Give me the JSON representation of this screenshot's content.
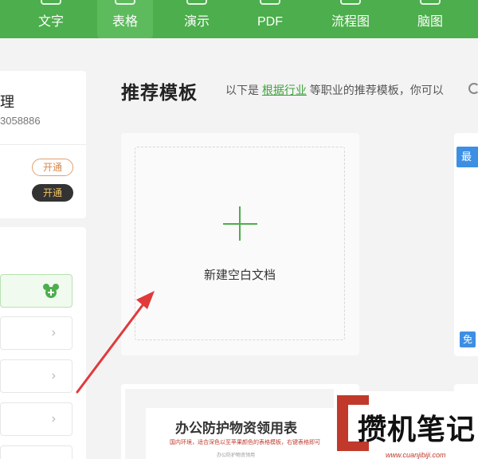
{
  "nav": {
    "tabs": [
      {
        "label": "文字"
      },
      {
        "label": "表格"
      },
      {
        "label": "演示"
      },
      {
        "label": "PDF"
      },
      {
        "label": "流程图"
      },
      {
        "label": "脑图"
      }
    ],
    "active_tab": "表格"
  },
  "account": {
    "name": "理",
    "id": "3058886",
    "open_outline_label": "开通",
    "open_dark_label": "开通"
  },
  "sidebar": {
    "items": [
      {
        "label": "",
        "selected": true
      },
      {
        "label": ""
      },
      {
        "label": ""
      },
      {
        "label": ""
      },
      {
        "label": ""
      }
    ]
  },
  "header": {
    "title": "推荐模板",
    "prefix": "以下是",
    "link": "根据行业",
    "suffix": "等职业的推荐模板，你可以"
  },
  "new_doc": {
    "label": "新建空白文档"
  },
  "side_card": {
    "badge_new": "最新",
    "badge_free": "免"
  },
  "template": {
    "title": "办公防护物资领用表",
    "subtitle": "国内环境，适合深色以至苹果颜色的表格模板，右键表格即可",
    "small": "办公防护物资领用"
  },
  "watermark": {
    "text": "攒机笔记",
    "url": "www.cuanjibiji.com"
  },
  "colors": {
    "brand": "#4cae4c",
    "link": "#3ea23e",
    "badge": "#3d8fe3",
    "arrow": "#e03a3a"
  }
}
